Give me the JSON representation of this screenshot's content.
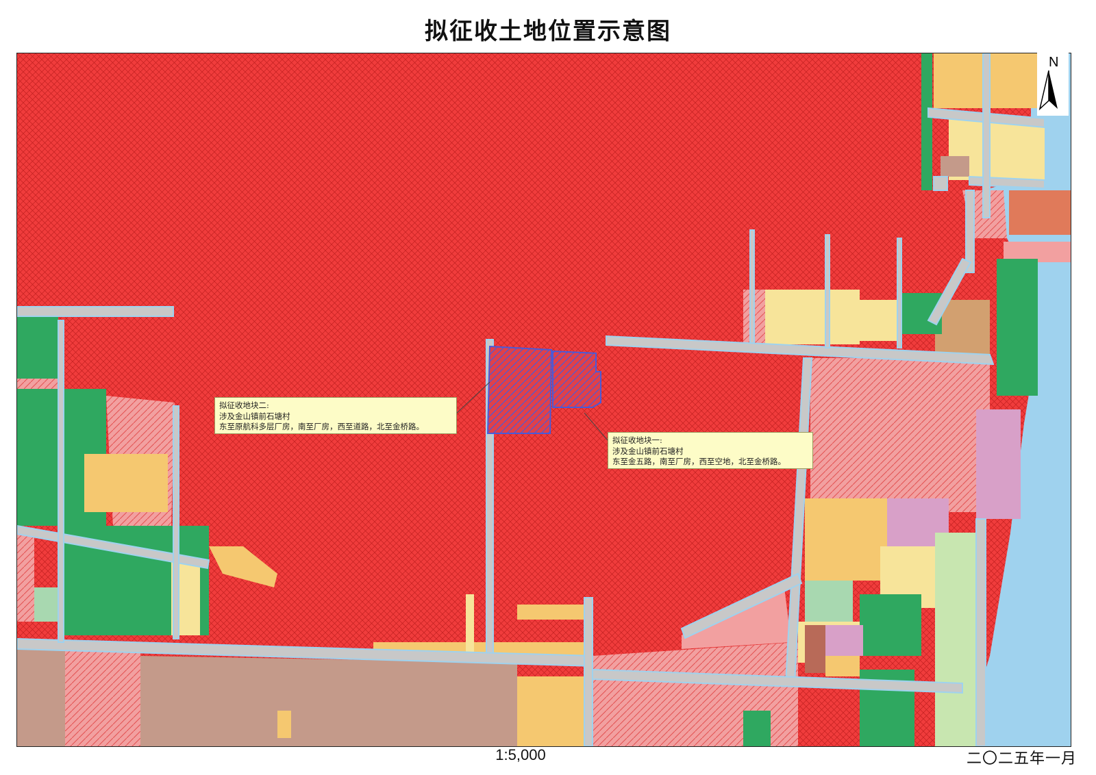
{
  "title": "拟征收土地位置示意图",
  "scale_label": "1:5,000",
  "date_label": "二〇二五年一月",
  "north_label": "N",
  "parcel_two": {
    "line1": "拟征收地块二:",
    "line2": "涉及金山镇前石塘村",
    "line3": "东至原航科多层厂房，南至厂房，西至道路，北至金桥路。"
  },
  "parcel_one": {
    "line1": "拟征收地块一:",
    "line2": "涉及金山镇前石塘村",
    "line3": "东至金五路，南至厂房，西至空地，北至金桥路。"
  },
  "colors": {
    "industrial_red": "#f03c3c",
    "planned_red_light": "#f2a0a0",
    "road_gray": "#c8c8c8",
    "water_blue": "#9fd2ee",
    "green_space": "#2fa860",
    "residential_yellow": "#f7e49a",
    "commercial_orange": "#f5c870",
    "brown_land": "#c49a8a",
    "pink_public": "#d8a0c8",
    "parcel_outline": "#4a5ad8"
  }
}
